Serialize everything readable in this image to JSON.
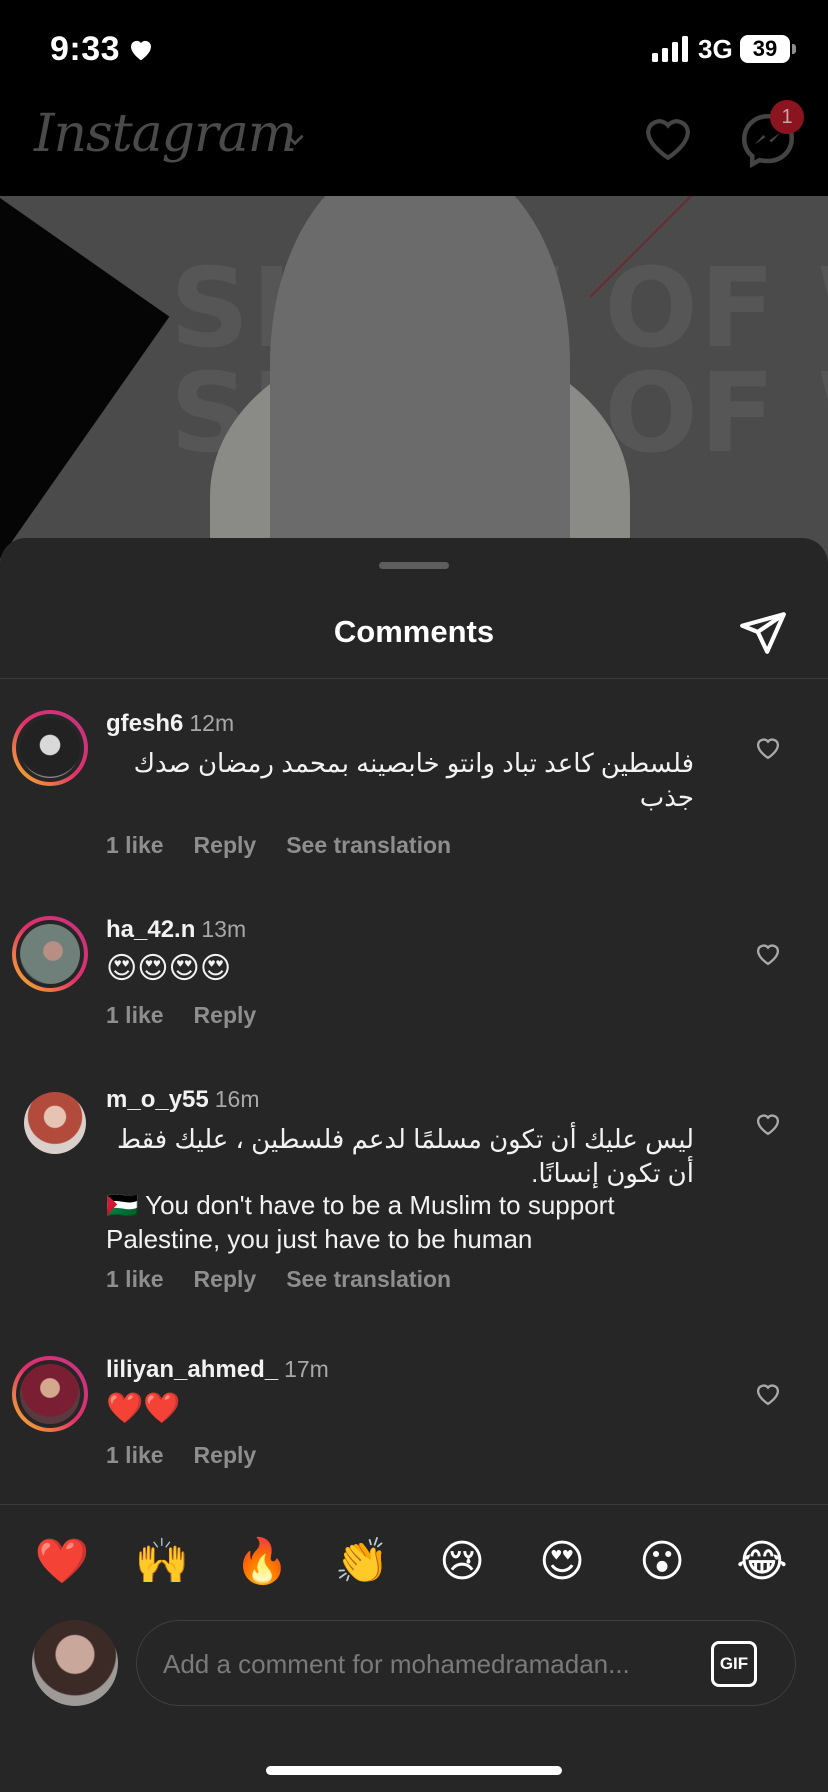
{
  "status_bar": {
    "time": "9:33",
    "network": "3G",
    "battery": "39"
  },
  "header": {
    "logo": "Instagram",
    "notification_badge": "1"
  },
  "sheet": {
    "title": "Comments"
  },
  "comments": [
    {
      "user": "gfesh6",
      "time": "12m",
      "text": "فلسطين كاعد تباد وانتو خابصينه بمحمد رمضان صدك جذب",
      "likes": "1 like",
      "reply": "Reply",
      "translate": "See translation"
    },
    {
      "user": "ha_42.n",
      "time": "13m",
      "text": "😍😍😍😍",
      "likes": "1 like",
      "reply": "Reply"
    },
    {
      "user": "m_o_y55",
      "time": "16m",
      "text": "ليس عليك أن تكون مسلمًا لدعم فلسطين ، عليك فقط أن تكون إنسانًا.",
      "text_en": "🇵🇸 You don't have to be a Muslim to support Palestine, you just have to be human",
      "likes": "1 like",
      "reply": "Reply",
      "translate": "See translation"
    },
    {
      "user": "liliyan_ahmed_",
      "time": "17m",
      "text": "❤️❤️",
      "likes": "1 like",
      "reply": "Reply"
    }
  ],
  "reactions": [
    "❤️",
    "🙌",
    "🔥",
    "👏",
    "😢",
    "😍",
    "😮",
    "😂"
  ],
  "composer": {
    "placeholder": "Add a comment for mohamedramadan...",
    "gif": "GIF"
  },
  "colors": {
    "sheet_bg": "#262626",
    "muted_text": "#8e8e8e",
    "badge": "#8a1420"
  }
}
